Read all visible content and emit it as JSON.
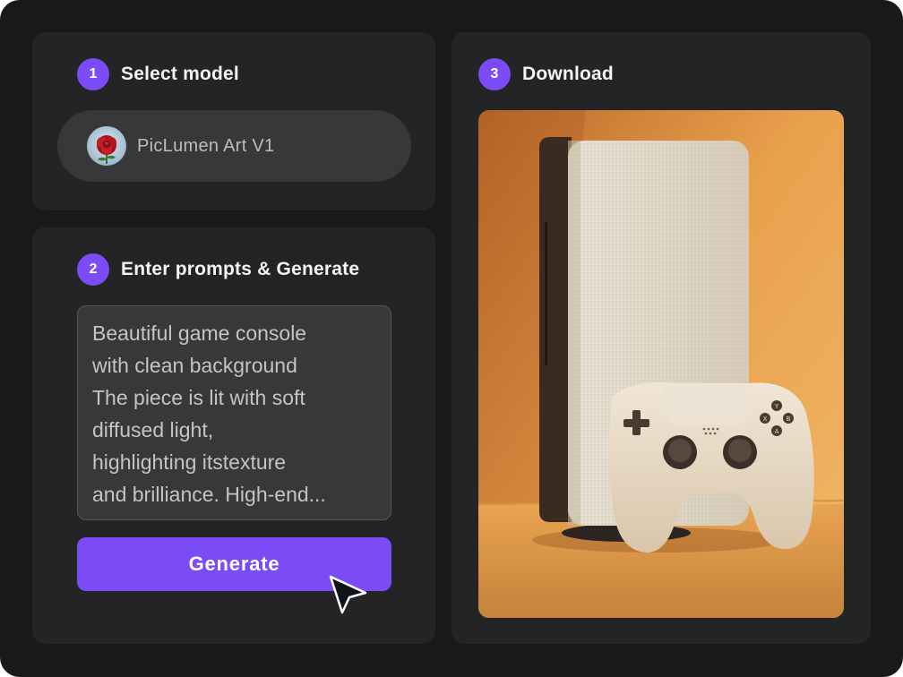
{
  "steps": [
    {
      "number": "1",
      "title": "Select model"
    },
    {
      "number": "2",
      "title": "Enter prompts & Generate"
    },
    {
      "number": "3",
      "title": "Download"
    }
  ],
  "model": {
    "name": "PicLumen Art V1",
    "icon": "rose-avatar"
  },
  "prompt": {
    "lines": [
      "Beautiful game console",
      "with clean background",
      "The piece is lit with soft",
      "diffused light,",
      "highlighting itstexture",
      "and brilliance. High-end..."
    ]
  },
  "generate": {
    "label": "Generate"
  },
  "colors": {
    "accent": "#7b4cf5",
    "background": "#18191b",
    "card": "#232426",
    "image_backdrop": "#e8a24a"
  },
  "controller_buttons": {
    "y": "Y",
    "x": "X",
    "b": "B",
    "a": "A"
  }
}
